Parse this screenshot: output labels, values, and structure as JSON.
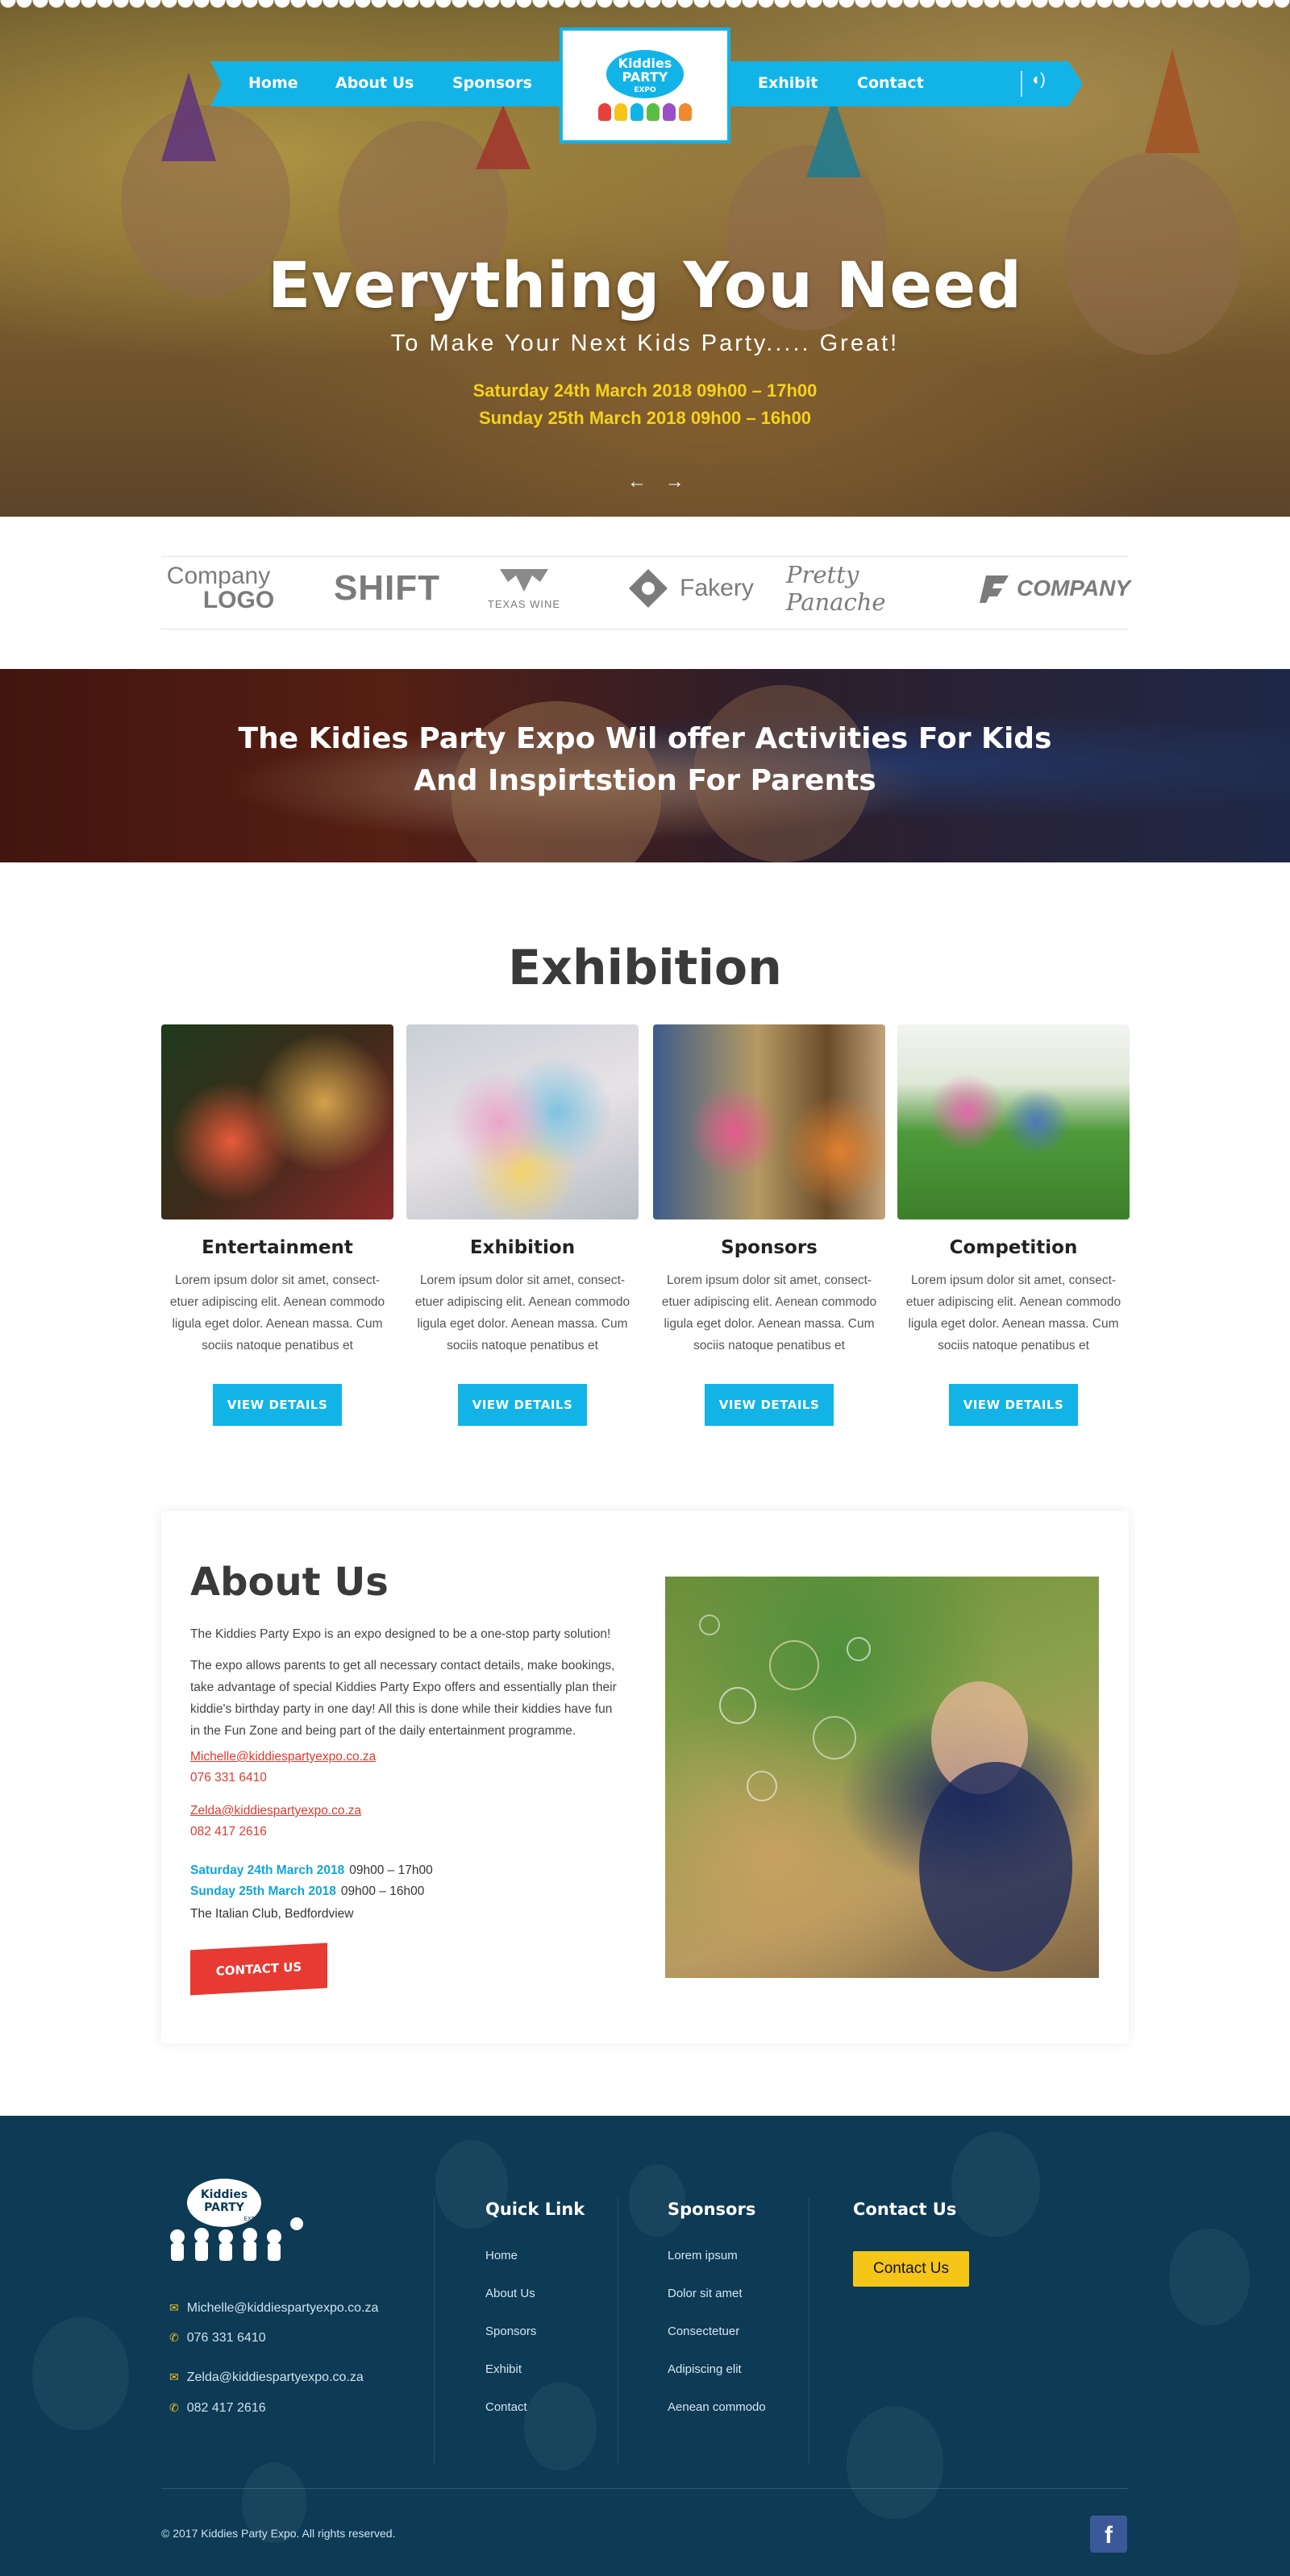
{
  "nav": {
    "items": [
      "Home",
      "About Us",
      "Sponsors",
      "Exhibit",
      "Contact"
    ],
    "logo_text": [
      "Kiddies",
      "PARTY",
      "EXPO"
    ]
  },
  "hero": {
    "title": "Everything You Need",
    "subtitle": "To Make Your Next Kids Party..... Great!",
    "dates": [
      "Saturday 24th March 2018   09h00 – 17h00",
      "Sunday 25th March 2018   09h00 – 16h00"
    ],
    "arrow_prev": "←",
    "arrow_next": "→"
  },
  "sponsors_strip": {
    "logos": [
      "Company",
      "LOGO",
      "SHIFT",
      "TEXAS WINE",
      "Fakery",
      "Pretty Panache",
      "COMPANY"
    ]
  },
  "banner": {
    "lines": [
      "The Kidies Party Expo Wil offer Activities For Kids",
      "And Inspirtstion For Parents"
    ]
  },
  "exhibition": {
    "title": "Exhibition",
    "cards": [
      {
        "title": "Entertainment",
        "text": "Lorem ipsum dolor sit amet, consect-etuer adipiscing elit. Aenean commodo ligula eget dolor. Aenean massa. Cum sociis natoque penatibus et",
        "button": "VIEW DETAILS"
      },
      {
        "title": "Exhibition",
        "text": "Lorem ipsum dolor sit amet, consect-etuer adipiscing elit. Aenean commodo ligula eget dolor. Aenean massa. Cum sociis natoque penatibus et",
        "button": "VIEW DETAILS"
      },
      {
        "title": "Sponsors",
        "text": "Lorem ipsum dolor sit amet, consect-etuer adipiscing elit. Aenean commodo ligula eget dolor. Aenean massa. Cum sociis natoque penatibus et",
        "button": "VIEW DETAILS"
      },
      {
        "title": "Competition",
        "text": "Lorem ipsum dolor sit amet, consect-etuer adipiscing elit. Aenean commodo ligula eget dolor. Aenean massa. Cum sociis natoque penatibus et",
        "button": "VIEW DETAILS"
      }
    ]
  },
  "about": {
    "title": "About Us",
    "intro": "The Kiddies Party Expo is an expo designed to be a one-stop party solution!",
    "body": "The expo allows parents to get all necessary contact details, make bookings, take advantage of special Kiddies Party Expo offers and essentially plan their kiddie's birthday party in one day!  All this is done while their kiddies have fun in the Fun Zone and being part of the daily entertainment programme.",
    "contact1_email": "Michelle@kiddiespartyexpo.co.za",
    "contact1_phone": "076 331 6410",
    "contact2_email": "Zelda@kiddiespartyexpo.co.za",
    "contact2_phone": "082 417 2616",
    "date1": "Saturday 24th March 2018",
    "time1": "09h00 – 17h00",
    "date2": "Sunday 25th March 2018",
    "time2": "09h00 – 16h00",
    "venue": "The Italian Club, Bedfordview",
    "button": "CONTACT US"
  },
  "footer": {
    "contacts": [
      {
        "icon": "mail-icon",
        "text": "Michelle@kiddiespartyexpo.co.za"
      },
      {
        "icon": "phone-icon",
        "text": "076 331 6410"
      },
      {
        "icon": "mail-icon",
        "text": "Zelda@kiddiespartyexpo.co.za"
      },
      {
        "icon": "phone-icon",
        "text": "082 417 2616"
      }
    ],
    "quick_link_title": "Quick Link",
    "quick_links": [
      "Home",
      "About Us",
      "Sponsors",
      "Exhibit",
      "Contact"
    ],
    "sponsors_title": "Sponsors",
    "sponsors": [
      "Lorem ipsum",
      "Dolor sit amet",
      "Consectetuer",
      "Adipiscing elit",
      "Aenean commodo"
    ],
    "contact_title": "Contact Us",
    "contact_button": "Contact Us",
    "copyright": "© 2017 Kiddies Party Expo. All rights reserved.",
    "facebook": "f"
  },
  "colors": {
    "accent_blue": "#12b4e8",
    "accent_red": "#e63a32",
    "accent_yellow": "#f5c518",
    "footer_bg": "#0d3a55"
  }
}
